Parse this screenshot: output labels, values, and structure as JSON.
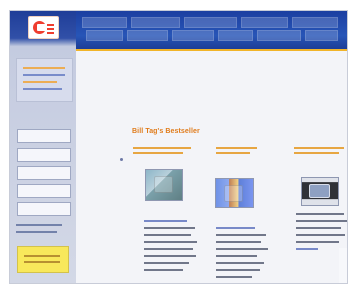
{
  "content": {
    "title": "Bill Tag's Bestseller"
  },
  "icons": {
    "logo": "brand-logo-icon",
    "bullet": "bullet-icon"
  },
  "colors": {
    "header_blue": "#2755b7",
    "accent_orange": "#e07b1a",
    "panel_yellow": "#f8e85b"
  }
}
